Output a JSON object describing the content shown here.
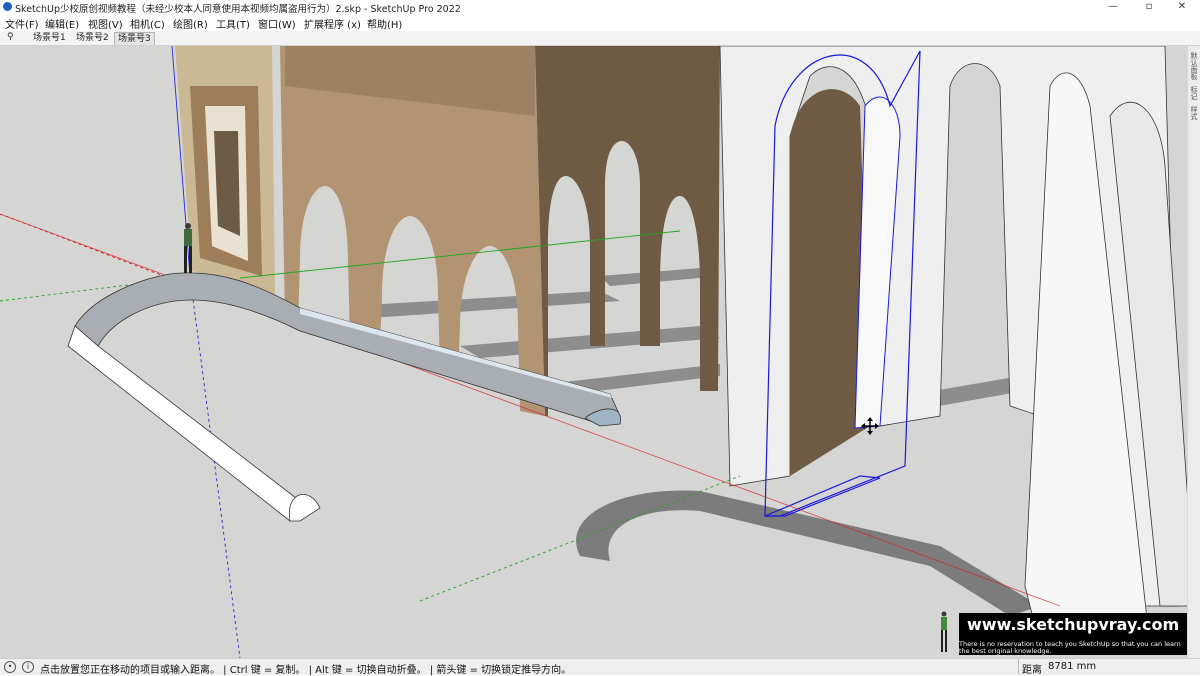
{
  "window": {
    "title": "SketchUp少校原创视频教程（未经少校本人同意使用本视频均属盗用行为）2.skp - SketchUp Pro 2022",
    "controls": {
      "minimize": "—",
      "maximize": "▫",
      "close": "✕"
    }
  },
  "menu": {
    "items": [
      {
        "label": "文件(F)"
      },
      {
        "label": "编辑(E)"
      },
      {
        "label": "视图(V)"
      },
      {
        "label": "相机(C)"
      },
      {
        "label": "绘图(R)"
      },
      {
        "label": "工具(T)"
      },
      {
        "label": "窗口(W)"
      },
      {
        "label": "扩展程序 (x)"
      },
      {
        "label": "帮助(H)"
      }
    ]
  },
  "scenes": {
    "tabs": [
      {
        "label": "场景号1",
        "active": false
      },
      {
        "label": "场景号2",
        "active": false
      },
      {
        "label": "场景号3",
        "active": true
      }
    ]
  },
  "side_panel": {
    "labels": [
      "默认面板",
      "标记",
      "样式"
    ]
  },
  "status": {
    "text": "点击放置您正在移动的项目或输入距离。 | Ctrl 键 = 复制。 | Alt 键 = 切换自动折叠。 | 箭头键 = 切换锁定推导方向。",
    "measure_label": "距离",
    "measure_value": "8781 mm",
    "icons": [
      "geo-location-icon",
      "info-icon"
    ]
  },
  "watermark": {
    "url": "www.sketchupvray.com",
    "line1": "There is no reservation to teach you SketchUp so that you can learn",
    "line2": "the best original knowledge."
  },
  "colors": {
    "sky": "#ffffff",
    "ground": "#d4d4d2",
    "wall_tan": "#b49777",
    "wall_tan_shadow": "#7a634a",
    "wall_white": "#f2f2f2",
    "selection_blue": "#1a1adb",
    "axis_red": "#d62020",
    "axis_green": "#1fa81f",
    "axis_blue": "#2a2ad6"
  }
}
